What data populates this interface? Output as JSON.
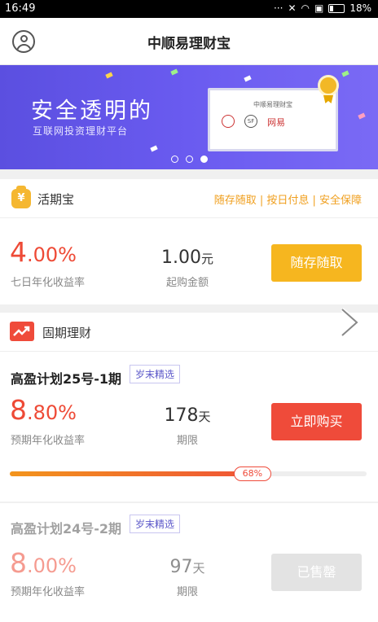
{
  "status_bar": {
    "time": "16:49",
    "icons": [
      "dots-icon",
      "mute-icon",
      "wifi-icon",
      "sim-icon"
    ],
    "battery": "18%"
  },
  "nav": {
    "title": "中顺易理财宝"
  },
  "banner": {
    "title": "安全透明的",
    "subtitle": "互联网投资理财平台",
    "card_title": "中顺易理财宝",
    "logo_sf": "SF",
    "logo_wy": "网易",
    "slides": 3,
    "active_slide": 3,
    "colors": {
      "bg_start": "#5b4fe0",
      "bg_end": "#7a6af5"
    }
  },
  "huoqi": {
    "title": "活期宝",
    "tags": "随存随取 | 按日付息 | 安全保障",
    "rate_int": "4",
    "rate_dec": ".00%",
    "rate_label": "七日年化收益率",
    "amount": "1.00",
    "amount_unit": "元",
    "amount_label": "起购金额",
    "button": "随存随取"
  },
  "dingqi": {
    "title": "固期理财",
    "products": [
      {
        "name": "高盈计划25号-1期",
        "tag": "岁末精选",
        "rate_int": "8",
        "rate_dec": ".80%",
        "rate_label": "预期年化收益率",
        "term": "178",
        "term_unit": "天",
        "term_label": "期限",
        "button": "立即购买",
        "progress_percent": 68,
        "progress_label": "68%"
      },
      {
        "name": "高盈计划24号-2期",
        "tag": "岁末精选",
        "rate_int": "8",
        "rate_dec": ".00%",
        "rate_label": "预期年化收益率",
        "term": "97",
        "term_unit": "天",
        "term_label": "期限",
        "button": "已售罄"
      }
    ]
  },
  "colors": {
    "accent_red": "#ef4b3a",
    "accent_yellow": "#f6b61f",
    "tag_purple": "#5b57c9"
  }
}
